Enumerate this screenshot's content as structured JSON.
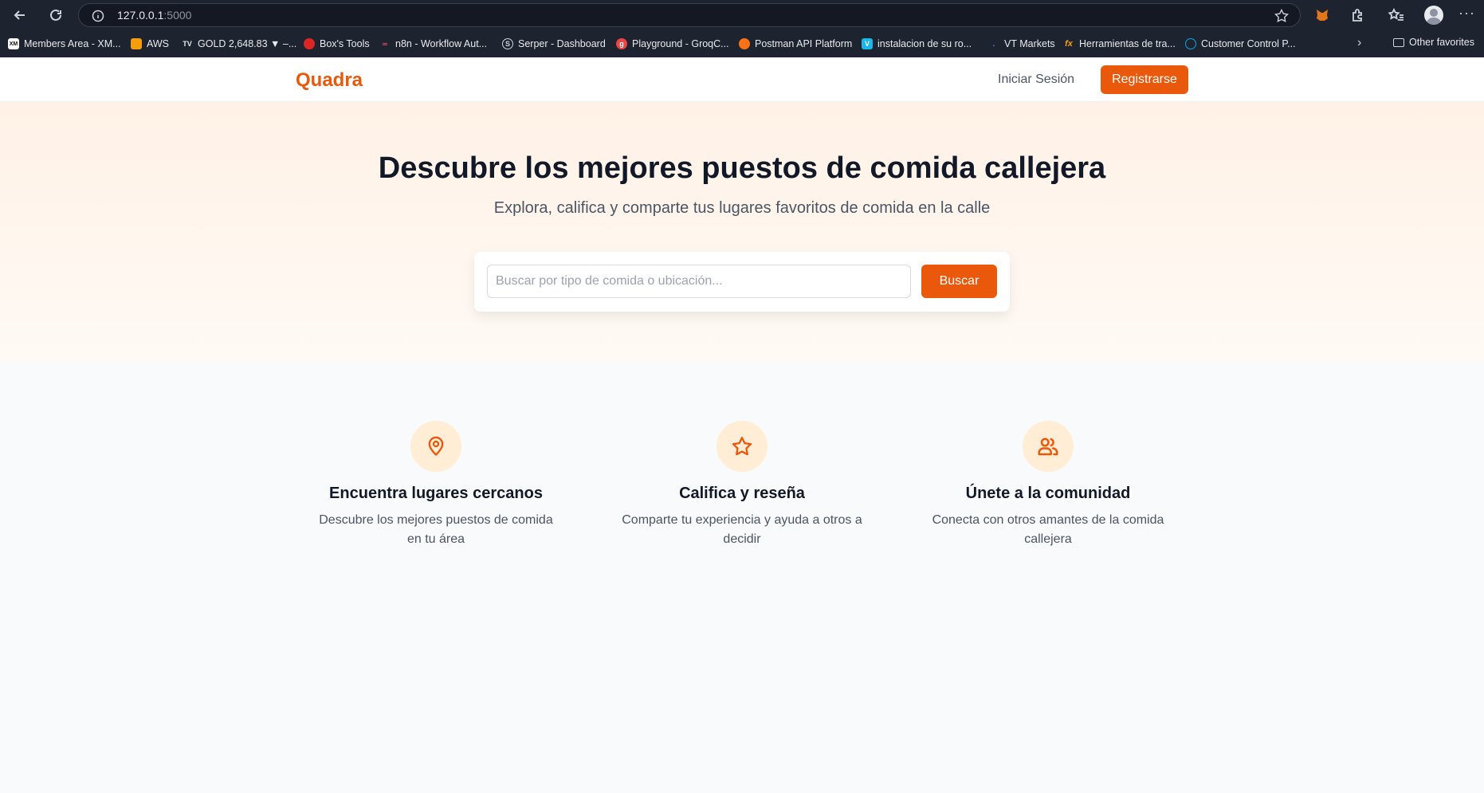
{
  "browser": {
    "url_host": "127.0.0.1",
    "url_port": ":5000",
    "bookmarks": [
      {
        "label": "Members Area - XM...",
        "color": "#ffffff",
        "glyph": "XM"
      },
      {
        "label": "AWS",
        "color": "#f59e0b",
        "glyph": ""
      },
      {
        "label": "GOLD 2,648.83 ▼ –...",
        "color": "#1e2330",
        "glyph": "TV"
      },
      {
        "label": "Box's Tools",
        "color": "#dc2626",
        "glyph": ""
      },
      {
        "label": "n8n - Workflow Aut...",
        "color": "#ea4b71",
        "glyph": ""
      },
      {
        "label": "Serper - Dashboard",
        "color": "#64748b",
        "glyph": "S"
      },
      {
        "label": "Playground - GroqC...",
        "color": "#ef4444",
        "glyph": "g"
      },
      {
        "label": "Postman API Platform",
        "color": "#f97316",
        "glyph": ""
      },
      {
        "label": "instalacion de su ro...",
        "color": "#1ab7ea",
        "glyph": "V"
      },
      {
        "label": "VT Markets",
        "color": "#1e3a8a",
        "glyph": ""
      },
      {
        "label": "Herramientas de tra...",
        "color": "#f59e0b",
        "glyph": "fx"
      },
      {
        "label": "Customer Control P...",
        "color": "#0ea5e9",
        "glyph": ""
      }
    ],
    "other_favorites": "Other favorites"
  },
  "nav": {
    "logo": "Quadra",
    "login": "Iniciar Sesión",
    "register": "Registrarse"
  },
  "hero": {
    "title": "Descubre los mejores puestos de comida callejera",
    "subtitle": "Explora, califica y comparte tus lugares favoritos de comida en la calle",
    "search": {
      "placeholder": "Buscar por tipo de comida o ubicación...",
      "value": "",
      "button": "Buscar"
    }
  },
  "features": [
    {
      "icon": "map-pin-icon",
      "title": "Encuentra lugares cercanos",
      "desc": "Descubre los mejores puestos de comida en tu área"
    },
    {
      "icon": "star-icon",
      "title": "Califica y reseña",
      "desc": "Comparte tu experiencia y ayuda a otros a decidir"
    },
    {
      "icon": "users-icon",
      "title": "Únete a la comunidad",
      "desc": "Conecta con otros amantes de la comida callejera"
    }
  ],
  "colors": {
    "accent": "#ea580c",
    "accent_light": "#ffedd5",
    "chrome_bg": "#1e2330"
  }
}
